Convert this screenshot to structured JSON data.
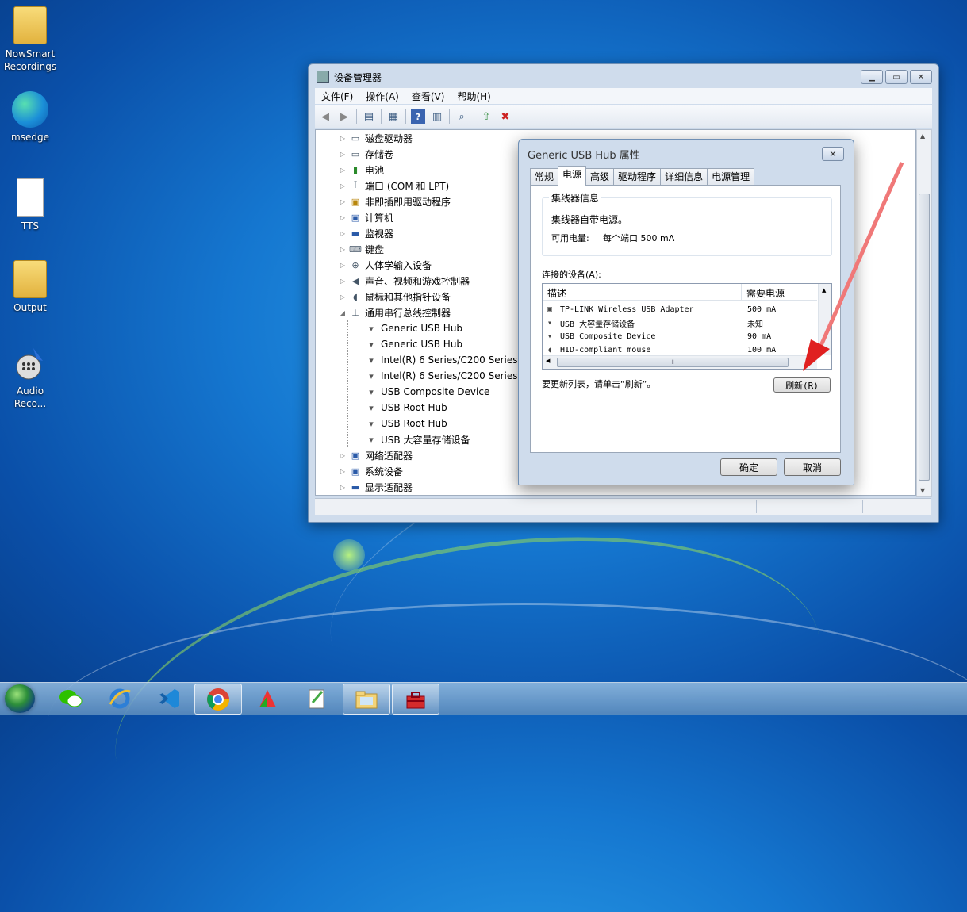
{
  "desktop": {
    "icons": [
      {
        "label_line1": "NowSmart",
        "label_line2": "Recordings",
        "icon": "folder-icon"
      },
      {
        "label_line1": "msedge",
        "label_line2": "",
        "icon": "edge-icon"
      },
      {
        "label_line1": "TTS",
        "label_line2": "",
        "icon": "text-file-icon"
      },
      {
        "label_line1": "Output",
        "label_line2": "",
        "icon": "folder-icon"
      },
      {
        "label_line1": "Audio",
        "label_line2": "Reco...",
        "icon": "audio-recorder-icon"
      }
    ]
  },
  "window": {
    "title": "设备管理器",
    "menu": [
      "文件(F)",
      "操作(A)",
      "查看(V)",
      "帮助(H)"
    ],
    "toolbar_icons": [
      "back-icon",
      "forward-icon",
      "show-hide-icon",
      "properties-icon",
      "help-icon",
      "view-icon",
      "scan-icon",
      "update-driver-icon",
      "uninstall-icon"
    ]
  },
  "tree": {
    "nodes": [
      {
        "label": "磁盘驱动器",
        "icon": "disk-icon",
        "expanded": false
      },
      {
        "label": "存储卷",
        "icon": "storage-icon",
        "expanded": false
      },
      {
        "label": "电池",
        "icon": "battery-icon",
        "expanded": false
      },
      {
        "label": "端口 (COM 和 LPT)",
        "icon": "port-icon",
        "expanded": false
      },
      {
        "label": "非即插即用驱动程序",
        "icon": "driver-icon",
        "expanded": false
      },
      {
        "label": "计算机",
        "icon": "computer-icon",
        "expanded": false
      },
      {
        "label": "监视器",
        "icon": "monitor-icon",
        "expanded": false
      },
      {
        "label": "键盘",
        "icon": "keyboard-icon",
        "expanded": false
      },
      {
        "label": "人体学输入设备",
        "icon": "hid-icon",
        "expanded": false
      },
      {
        "label": "声音、视频和游戏控制器",
        "icon": "sound-icon",
        "expanded": false
      },
      {
        "label": "鼠标和其他指针设备",
        "icon": "mouse-icon",
        "expanded": false
      },
      {
        "label": "通用串行总线控制器",
        "icon": "usb-icon",
        "expanded": true
      },
      {
        "label": "网络适配器",
        "icon": "network-icon",
        "expanded": false
      },
      {
        "label": "系统设备",
        "icon": "system-icon",
        "expanded": false
      },
      {
        "label": "显示适配器",
        "icon": "display-icon",
        "expanded": false
      }
    ],
    "usb_children": [
      "Generic USB Hub",
      "Generic USB Hub",
      "Intel(R) 6 Series/C200 Series C",
      "Intel(R) 6 Series/C200 Series C",
      "USB Composite Device",
      "USB Root Hub",
      "USB Root Hub",
      "USB 大容量存储设备"
    ]
  },
  "dialog": {
    "title": "Generic USB Hub 属性",
    "close": "✕",
    "tabs": [
      "常规",
      "电源",
      "高级",
      "驱动程序",
      "详细信息",
      "电源管理"
    ],
    "active_tab": "电源",
    "hub_group": {
      "legend": "集线器信息",
      "self_powered": "集线器自带电源。",
      "power_label": "可用电量:",
      "power_value": "每个端口 500 mA"
    },
    "devices_label": "连接的设备(A):",
    "columns": [
      "描述",
      "需要电源"
    ],
    "devices": [
      {
        "desc": "TP-LINK Wireless USB Adapter",
        "power": "500 mA"
      },
      {
        "desc": "USB 大容量存储设备",
        "power": "未知"
      },
      {
        "desc": "USB Composite Device",
        "power": "90 mA"
      },
      {
        "desc": "HID-compliant mouse",
        "power": "100 mA"
      }
    ],
    "refresh_hint": "要更新列表，请单击“刷新”。",
    "refresh_button": "刷新(R)",
    "ok": "确定",
    "cancel": "取消"
  },
  "annotation_color": "#e02020",
  "taskbar": {
    "items": [
      "wechat-icon",
      "ie-icon",
      "vscode-icon",
      "chrome-icon",
      "pdf-icon",
      "notepad-icon",
      "explorer-icon",
      "toolbox-icon"
    ]
  }
}
